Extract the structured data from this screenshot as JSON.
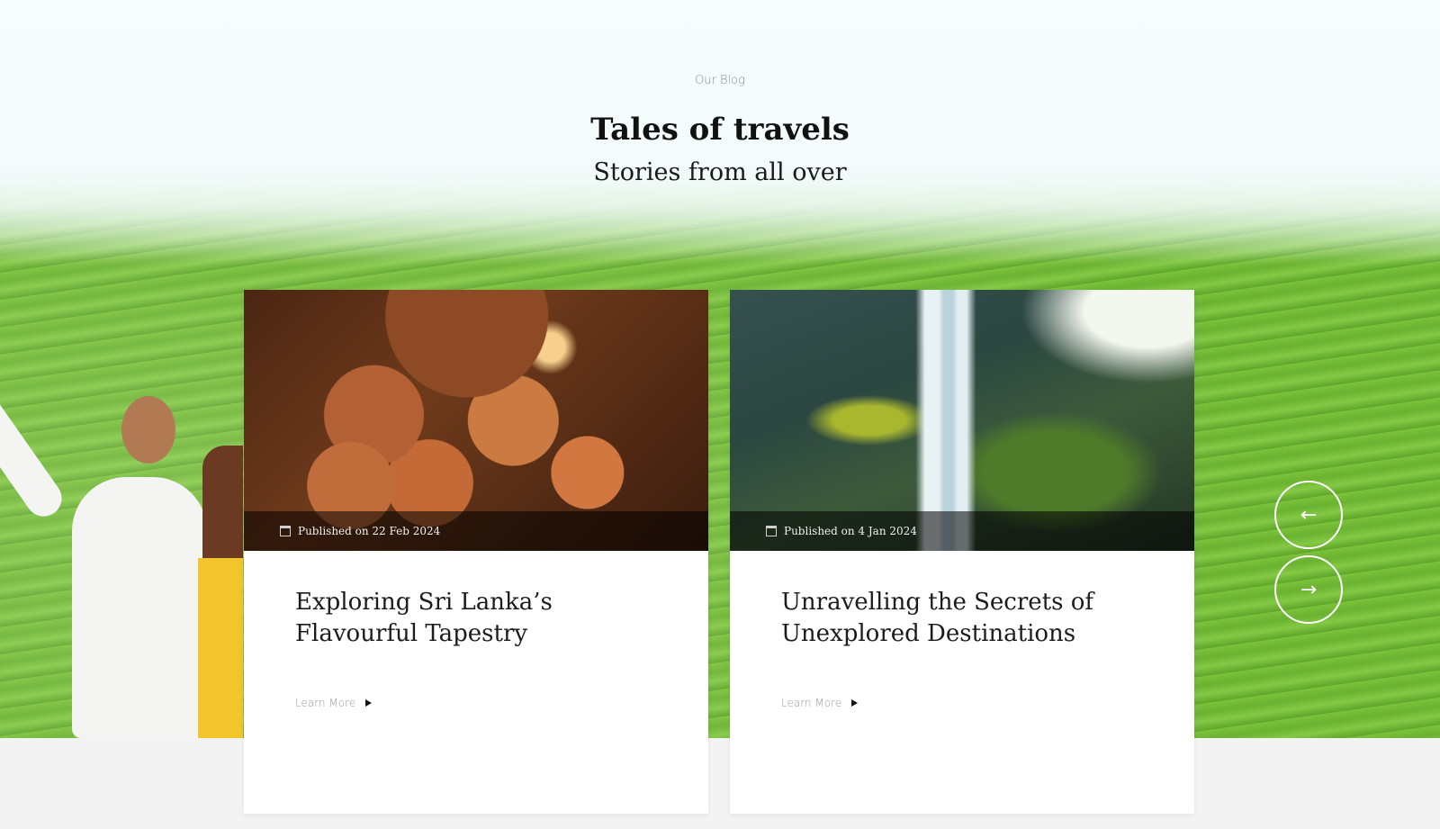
{
  "section": {
    "eyebrow": "Our Blog",
    "title": "Tales of travels",
    "subtitle": "Stories from all over"
  },
  "cards": [
    {
      "image": "sri-lankan-food-spread",
      "published": "Published on 22 Feb 2024",
      "title": "Exploring Sri Lanka’s Flavourful Tapestry",
      "cta": "Learn More"
    },
    {
      "image": "waterfall-hiker",
      "published": "Published on 4 Jan 2024",
      "title": "Unravelling the Secrets of Unexplored Destinations",
      "cta": "Learn More"
    }
  ],
  "carousel": {
    "prev_icon": "arrow-left-icon",
    "next_icon": "arrow-right-icon",
    "prev_glyph": "←",
    "next_glyph": "→"
  },
  "colors": {
    "accent": "#ffffff",
    "title": "#111111",
    "muted": "#8a8a8a",
    "meta_bar": "#000000"
  }
}
